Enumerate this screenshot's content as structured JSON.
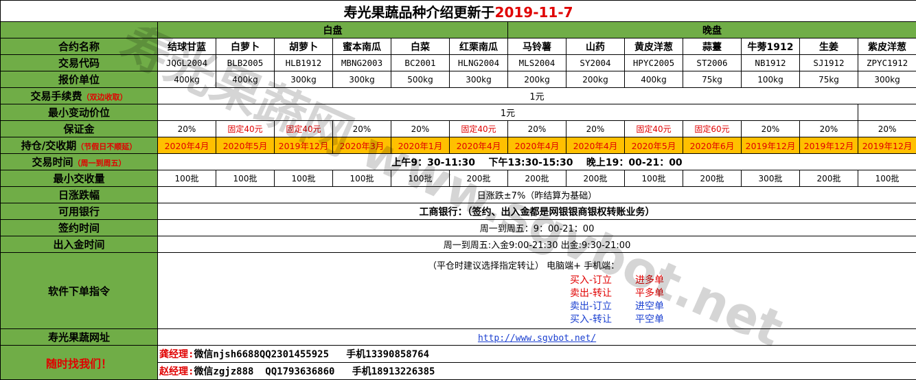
{
  "title": {
    "main": "寿光果蔬品种介绍更新于",
    "date": "2019-11-7"
  },
  "groups": {
    "day": "白盘",
    "night": "晚盘"
  },
  "labels": {
    "contract_name": "合约名称",
    "trade_code": "交易代码",
    "quote_unit": "报价单位",
    "fee": "交易手续费",
    "fee_note": "（双边收取）",
    "min_tick": "最小变动价位",
    "margin": "保证金",
    "delivery": "持仓/交收期",
    "delivery_note": "（节假日不顺延）",
    "trade_time": "交易时间",
    "trade_time_note": "（周一到周五）",
    "min_lot": "最小交收量",
    "limit": "日涨跌幅",
    "bank": "可用银行",
    "sign_time": "签约时间",
    "funds_time": "出入金时间",
    "order_cmd": "软件下单指令",
    "website": "寿光果蔬网址",
    "call_us": "随时找我们！"
  },
  "products": [
    {
      "name": "结球甘蓝",
      "code": "JQGL2004",
      "unit": "400kg",
      "margin": "20%",
      "delivery": "2020年4月",
      "lot": "100批"
    },
    {
      "name": "白萝卜",
      "code": "BLB2005",
      "unit": "400kg",
      "margin": "固定40元",
      "delivery": "2020年5月",
      "lot": "100批"
    },
    {
      "name": "胡萝卜",
      "code": "HLB1912",
      "unit": "300kg",
      "margin": "固定40元",
      "delivery": "2019年12月",
      "lot": "100批"
    },
    {
      "name": "蜜本南瓜",
      "code": "MBNG2003",
      "unit": "300kg",
      "margin": "20%",
      "delivery": "2020年3月",
      "lot": "100批"
    },
    {
      "name": "白菜",
      "code": "BC2001",
      "unit": "500kg",
      "margin": "20%",
      "delivery": "2020年1月",
      "lot": "100批"
    },
    {
      "name": "红栗南瓜",
      "code": "HLNG2004",
      "unit": "300kg",
      "margin": "固定40元",
      "delivery": "2020年4月",
      "lot": "200批"
    },
    {
      "name": "马铃薯",
      "code": "MLS2004",
      "unit": "200kg",
      "margin": "20%",
      "delivery": "2020年4月",
      "lot": "200批"
    },
    {
      "name": "山药",
      "code": "SY2004",
      "unit": "200kg",
      "margin": "20%",
      "delivery": "2020年4月",
      "lot": "200批"
    },
    {
      "name": "黄皮洋葱",
      "code": "HPYC2005",
      "unit": "400kg",
      "margin": "固定40元",
      "delivery": "2020年5月",
      "lot": "100批"
    },
    {
      "name": "蒜薹",
      "code": "ST2006",
      "unit": "75kg",
      "margin": "固定60元",
      "delivery": "2020年6月",
      "lot": "200批"
    },
    {
      "name": "牛蒡1912",
      "code": "NB1912",
      "unit": "100kg",
      "margin": "20%",
      "delivery": "2019年12月",
      "lot": "300批"
    },
    {
      "name": "生姜",
      "code": "SJ1912",
      "unit": "75kg",
      "margin": "20%",
      "delivery": "2019年12月",
      "lot": "200批"
    },
    {
      "name": "紫皮洋葱",
      "code": "ZPYC1912",
      "unit": "300kg",
      "margin": "20%",
      "delivery": "2019年12月",
      "lot": "100批"
    }
  ],
  "values": {
    "fee": "1元",
    "min_tick": "1元",
    "trade_time": "上午9：30-11:30    下午13:30-15:30    晚上19：00-21：00",
    "limit": "日涨跌±7%（昨结算为基础）",
    "bank": "工商银行：（签约、出入金都是网银银商银权转账业务）",
    "sign_time": "周一到周五：9：00-21：00",
    "funds_time": "周一到周五:入金9:00-21:30 出金:9:30-21:00",
    "order_head": "（平仓时建议选择指定转让）  电脑端+ 手机端：",
    "orders": [
      {
        "a": "买入-订立",
        "b": "进多单",
        "color": "#e00000"
      },
      {
        "a": "卖出-转让",
        "b": "平多单",
        "color": "#e00000"
      },
      {
        "a": "卖出-订立",
        "b": "进空单",
        "color": "#1a3fd0"
      },
      {
        "a": "买入-转让",
        "b": "平空单",
        "color": "#1a3fd0"
      }
    ],
    "url": "http://www.sgvbot.net/"
  },
  "contacts": [
    {
      "mgr": "龚经理:",
      "info": "微信njsh6688QQ2301455925   手机13390858764"
    },
    {
      "mgr": "赵经理:",
      "info": "微信zgjz888  QQ1793636860   手机18913226385"
    }
  ],
  "watermark": "寿光果蔬网 www.sgvbot.net"
}
